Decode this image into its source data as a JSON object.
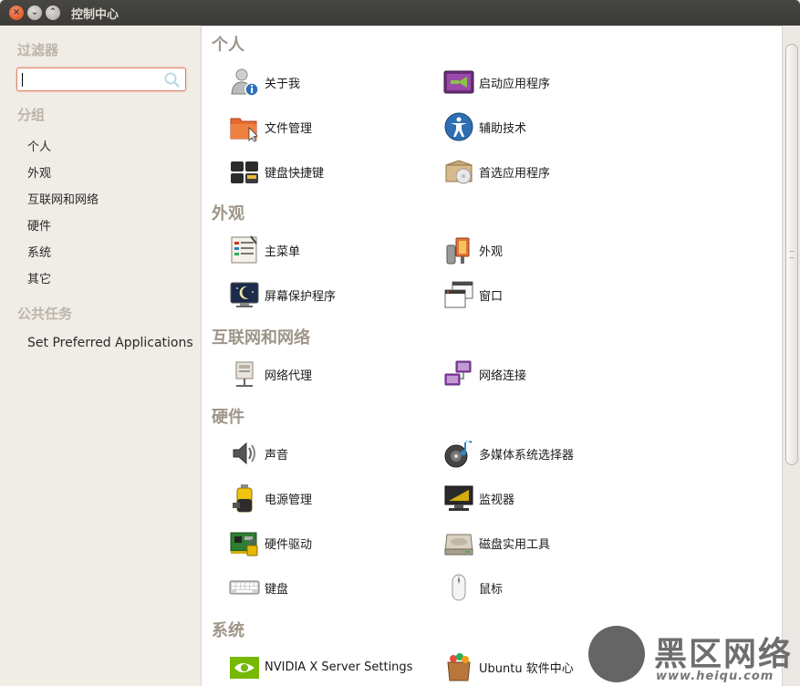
{
  "window": {
    "title": "控制中心",
    "close_glyph": "×",
    "min_glyph": "⌄",
    "max_glyph": "⌃"
  },
  "sidebar": {
    "filter_heading": "过滤器",
    "search_value": "",
    "group_heading": "分组",
    "groups": [
      "个人",
      "外观",
      "互联网和网络",
      "硬件",
      "系统",
      "其它"
    ],
    "tasks_heading": "公共任务",
    "tasks": [
      "Set Preferred Applications"
    ]
  },
  "sections": [
    {
      "title": "个人",
      "items": [
        {
          "label": "关于我",
          "icon": "user-info-icon"
        },
        {
          "label": "启动应用程序",
          "icon": "startup-apps-icon"
        },
        {
          "label": "文件管理",
          "icon": "file-manager-icon"
        },
        {
          "label": "辅助技术",
          "icon": "accessibility-icon"
        },
        {
          "label": "键盘快捷键",
          "icon": "keyboard-shortcuts-icon"
        },
        {
          "label": "首选应用程序",
          "icon": "preferred-apps-icon"
        }
      ]
    },
    {
      "title": "外观",
      "items": [
        {
          "label": "主菜单",
          "icon": "main-menu-icon"
        },
        {
          "label": "外观",
          "icon": "appearance-icon"
        },
        {
          "label": "屏幕保护程序",
          "icon": "screensaver-icon"
        },
        {
          "label": "窗口",
          "icon": "windows-icon"
        }
      ]
    },
    {
      "title": "互联网和网络",
      "items": [
        {
          "label": "网络代理",
          "icon": "network-proxy-icon"
        },
        {
          "label": "网络连接",
          "icon": "network-connections-icon"
        }
      ]
    },
    {
      "title": "硬件",
      "items": [
        {
          "label": "声音",
          "icon": "sound-icon"
        },
        {
          "label": "多媒体系统选择器",
          "icon": "multimedia-selector-icon"
        },
        {
          "label": "电源管理",
          "icon": "power-management-icon"
        },
        {
          "label": "监视器",
          "icon": "monitor-icon"
        },
        {
          "label": "硬件驱动",
          "icon": "hardware-drivers-icon"
        },
        {
          "label": "磁盘实用工具",
          "icon": "disk-utility-icon"
        },
        {
          "label": "键盘",
          "icon": "keyboard-icon"
        },
        {
          "label": "鼠标",
          "icon": "mouse-icon"
        }
      ]
    },
    {
      "title": "系统",
      "items": [
        {
          "label": "NVIDIA X Server Settings",
          "icon": "nvidia-icon"
        },
        {
          "label": "Ubuntu 软件中心",
          "icon": "software-center-icon"
        }
      ]
    }
  ],
  "watermark": {
    "text": "黑区网络",
    "url": "www.heiqu.com"
  },
  "colors": {
    "heading": "#9e9588",
    "sidebar_bg": "#f0ece6",
    "search_border": "#e0846a",
    "titlebar": "#3c3b37"
  }
}
